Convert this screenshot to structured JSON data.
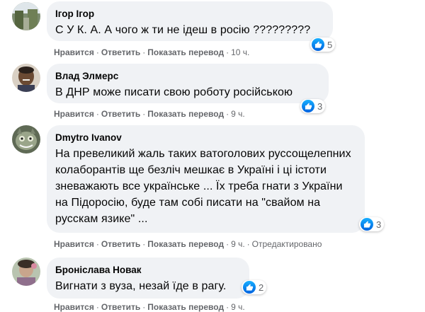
{
  "actions": {
    "like": "Нравится",
    "reply": "Ответить",
    "translate": "Показать перевод",
    "edited": "Отредактировано"
  },
  "comments": [
    {
      "author": "Ігор Ігор",
      "text": "С У К. А. А чого ж ти не ідеш в росію ?????????",
      "reactions": "5",
      "time": "10 ч."
    },
    {
      "author": "Влад Элмерс",
      "text": "В ДНР може писати свою роботу російською",
      "reactions": "3",
      "time": "9 ч."
    },
    {
      "author": "Dmytro Ivanov",
      "text": "На превеликий жаль таких ватоголових руссощелепних колаборантів ще безліч мешкає в Україні і ці істоти зневажають все українське ... Їх треба гнати з України на Підоросію, буде там собі писати на \"свайом на русскам язике\" ...",
      "reactions": "3",
      "time": "9 ч."
    },
    {
      "author": "Броніслава Новак",
      "text": "Вигнати з вуза, незай їде в рагу.",
      "reactions": "2",
      "time": "9 ч."
    }
  ],
  "colors": {
    "bubble": "#f0f2f5",
    "meta": "#65676b",
    "like_blue": "#0866ff"
  }
}
